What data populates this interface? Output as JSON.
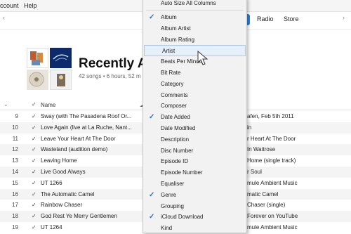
{
  "menubar": {
    "account": "ccount",
    "help": "Help"
  },
  "strip": {
    "radio": "Radio",
    "store": "Store"
  },
  "playlist": {
    "title": "Recently Ac",
    "subtitle": "42 songs • 6 hours, 52 m"
  },
  "table": {
    "header_name": "Name",
    "rows": [
      {
        "num": "9",
        "name": "Sway (with The Pasadena Roof Or...",
        "album": "afen, Feb 5th 2011"
      },
      {
        "num": "10",
        "name": "Love Again (live at La Ruche, Nant...",
        "album": "in"
      },
      {
        "num": "11",
        "name": "Leave Your Heart At The Door",
        "album": "r Heart At The Door"
      },
      {
        "num": "12",
        "name": "Wasteland (audition demo)",
        "album": "In Waitrose"
      },
      {
        "num": "13",
        "name": "Leaving Home",
        "album": "Home (single track)"
      },
      {
        "num": "14",
        "name": "Live Good Always",
        "album": "r Soul"
      },
      {
        "num": "15",
        "name": "UT 1266",
        "album": "mule Ambient Music"
      },
      {
        "num": "16",
        "name": "The Automatic Camel",
        "album": "matic Camel"
      },
      {
        "num": "17",
        "name": "Rainbow Chaser",
        "album": "Chaser (single)"
      },
      {
        "num": "18",
        "name": "God Rest Ye Merry Gentlemen",
        "album": "Forever on YouTube"
      },
      {
        "num": "19",
        "name": "UT 1264",
        "album": "mule Ambient Music"
      }
    ]
  },
  "context_menu": {
    "items": [
      {
        "label": "Auto Size All Columns",
        "checked": false
      },
      {
        "label": "Album",
        "checked": true
      },
      {
        "label": "Album Artist",
        "checked": false
      },
      {
        "label": "Album Rating",
        "checked": false
      },
      {
        "label": "Artist",
        "checked": false,
        "highlighted": true
      },
      {
        "label": "Beats Per Minute",
        "checked": false
      },
      {
        "label": "Bit Rate",
        "checked": false
      },
      {
        "label": "Category",
        "checked": false
      },
      {
        "label": "Comments",
        "checked": false
      },
      {
        "label": "Composer",
        "checked": false
      },
      {
        "label": "Date Added",
        "checked": true
      },
      {
        "label": "Date Modified",
        "checked": false
      },
      {
        "label": "Description",
        "checked": false
      },
      {
        "label": "Disc Number",
        "checked": false
      },
      {
        "label": "Episode ID",
        "checked": false
      },
      {
        "label": "Episode Number",
        "checked": false
      },
      {
        "label": "Equaliser",
        "checked": false
      },
      {
        "label": "Genre",
        "checked": true
      },
      {
        "label": "Grouping",
        "checked": false
      },
      {
        "label": "iCloud Download",
        "checked": true
      },
      {
        "label": "Kind",
        "checked": false
      }
    ]
  },
  "colors": {
    "accent": "#2f7ed8",
    "menu_bg": "#f2f2f2",
    "highlight": "#e6f0fb"
  }
}
